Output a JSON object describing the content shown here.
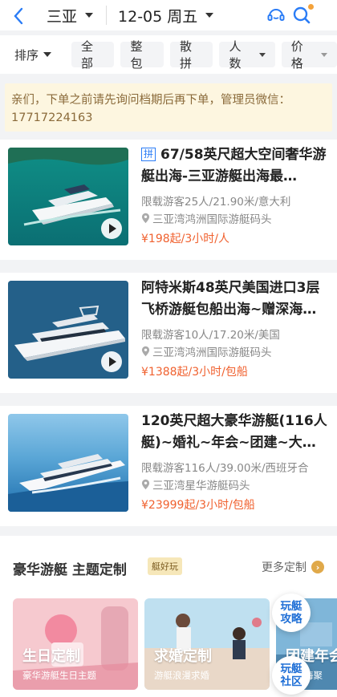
{
  "header": {
    "city": "三亚",
    "date": "12-05 周五"
  },
  "filters": {
    "sort_label": "排序",
    "chips": [
      "全部",
      "整包",
      "散拼",
      "人数",
      "价格"
    ]
  },
  "notice": "亲们，下单之前请先询问档期后再下单，管理员微信：17717224163",
  "listings": [
    {
      "badge": "拼",
      "title": "67/58英尺超大空间奢华游艇出海-三亚游艇出海最…",
      "spec": "限载游客25人/21.90米/意大利",
      "location": "三亚湾鸿洲国际游艇码头",
      "price": "¥198起/3小时/人"
    },
    {
      "badge": "",
      "title": "阿特米斯48英尺美国进口3层飞桥游艇包船出海~赠深海…",
      "spec": "限载游客10人/17.20米/美国",
      "location": "三亚湾鸿洲国际游艇码头",
      "price": "¥1388起/3小时/包船"
    },
    {
      "badge": "",
      "title": "120英尺超大豪华游艇(116人艇)~婚礼~年会~团建~大…",
      "spec": "限载游客116人/39.00米/西班牙合",
      "location": "三亚湾星华游艇码头",
      "price": "¥23999起/3小时/包船"
    }
  ],
  "section": {
    "title": "豪华游艇 主题定制",
    "tag": "艇好玩",
    "more": "更多定制",
    "tiles": [
      {
        "title": "生日定制",
        "sub": "豪华游艇生日主题"
      },
      {
        "title": "求婚定制",
        "sub": "游艇浪漫求婚"
      },
      {
        "title": "团建年会",
        "sub": "游艇海聚"
      }
    ]
  },
  "floating": {
    "guide": "玩艇攻略",
    "community": "玩艇社区"
  },
  "colors": {
    "accent": "#2a7cf6",
    "price": "#f0612f",
    "notice_bg": "#fdf6e0"
  }
}
